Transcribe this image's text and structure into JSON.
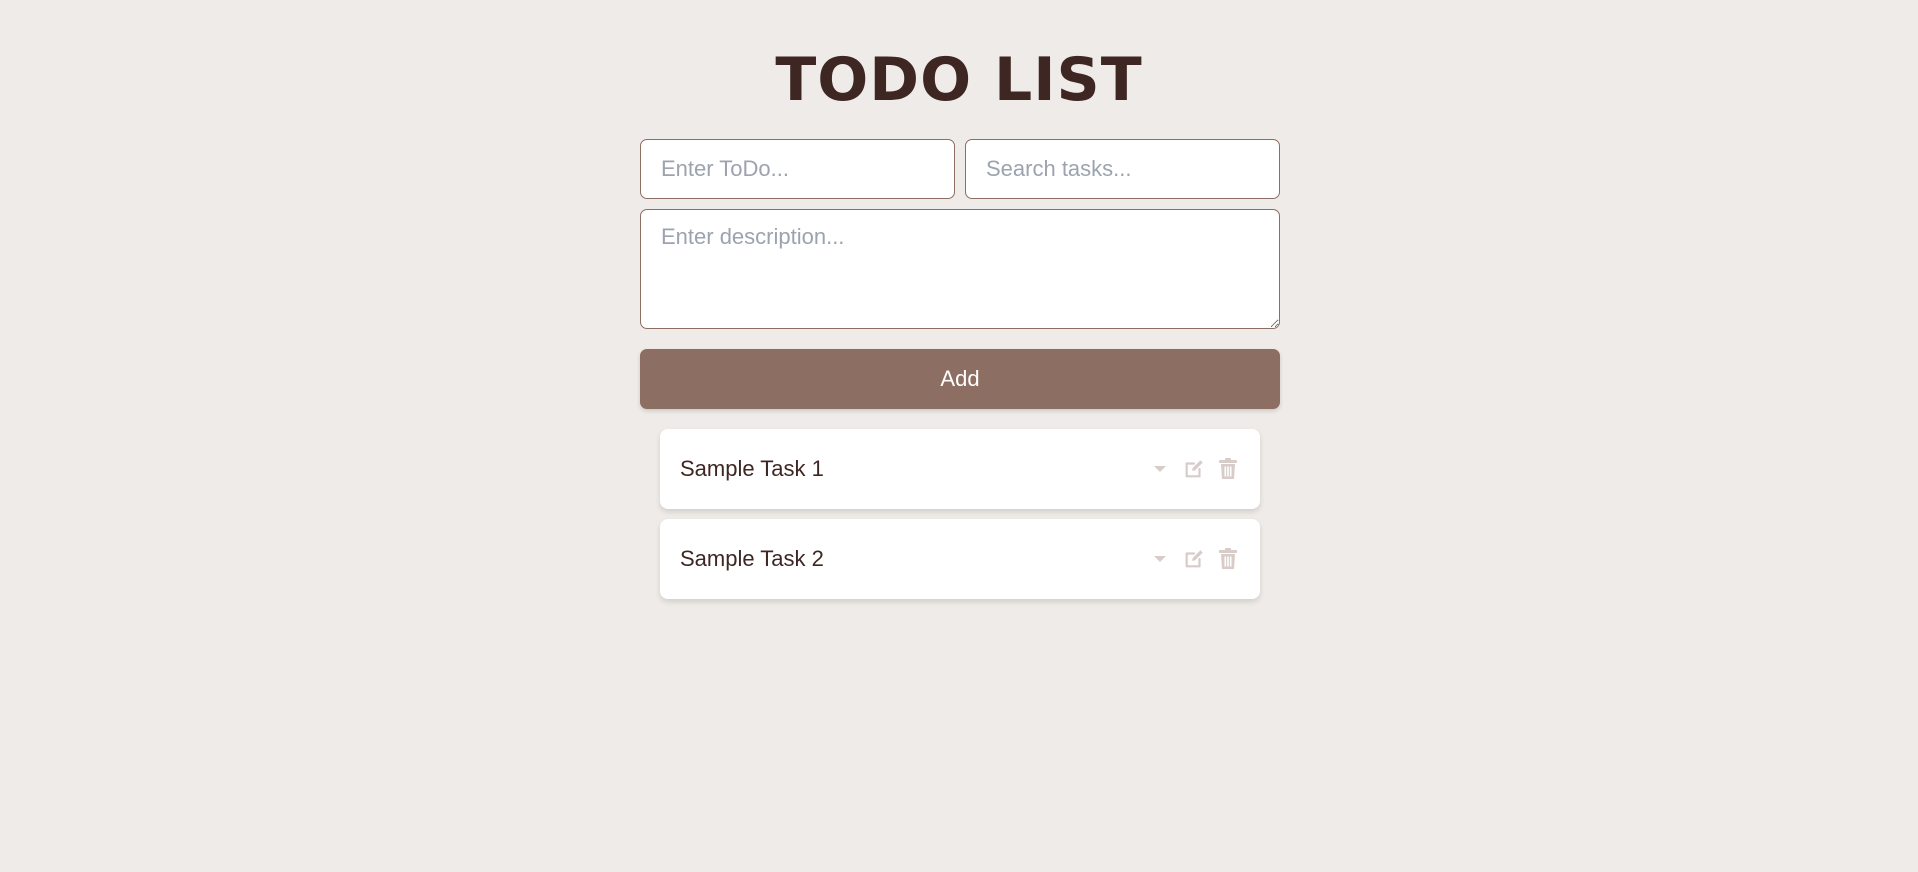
{
  "header": {
    "title": "TODO LIST"
  },
  "form": {
    "todo_placeholder": "Enter ToDo...",
    "todo_value": "",
    "search_placeholder": "Search tasks...",
    "search_value": "",
    "description_placeholder": "Enter description...",
    "description_value": "",
    "add_label": "Add"
  },
  "tasks": [
    {
      "title": "Sample Task 1",
      "icons": [
        "caret-down-icon",
        "edit-icon",
        "trash-icon"
      ]
    },
    {
      "title": "Sample Task 2",
      "icons": [
        "caret-down-icon",
        "edit-icon",
        "trash-icon"
      ]
    }
  ],
  "colors": {
    "background": "#efebe8",
    "title": "#3e2723",
    "accent": "#8d6e63",
    "icon": "#d7ccc8"
  }
}
